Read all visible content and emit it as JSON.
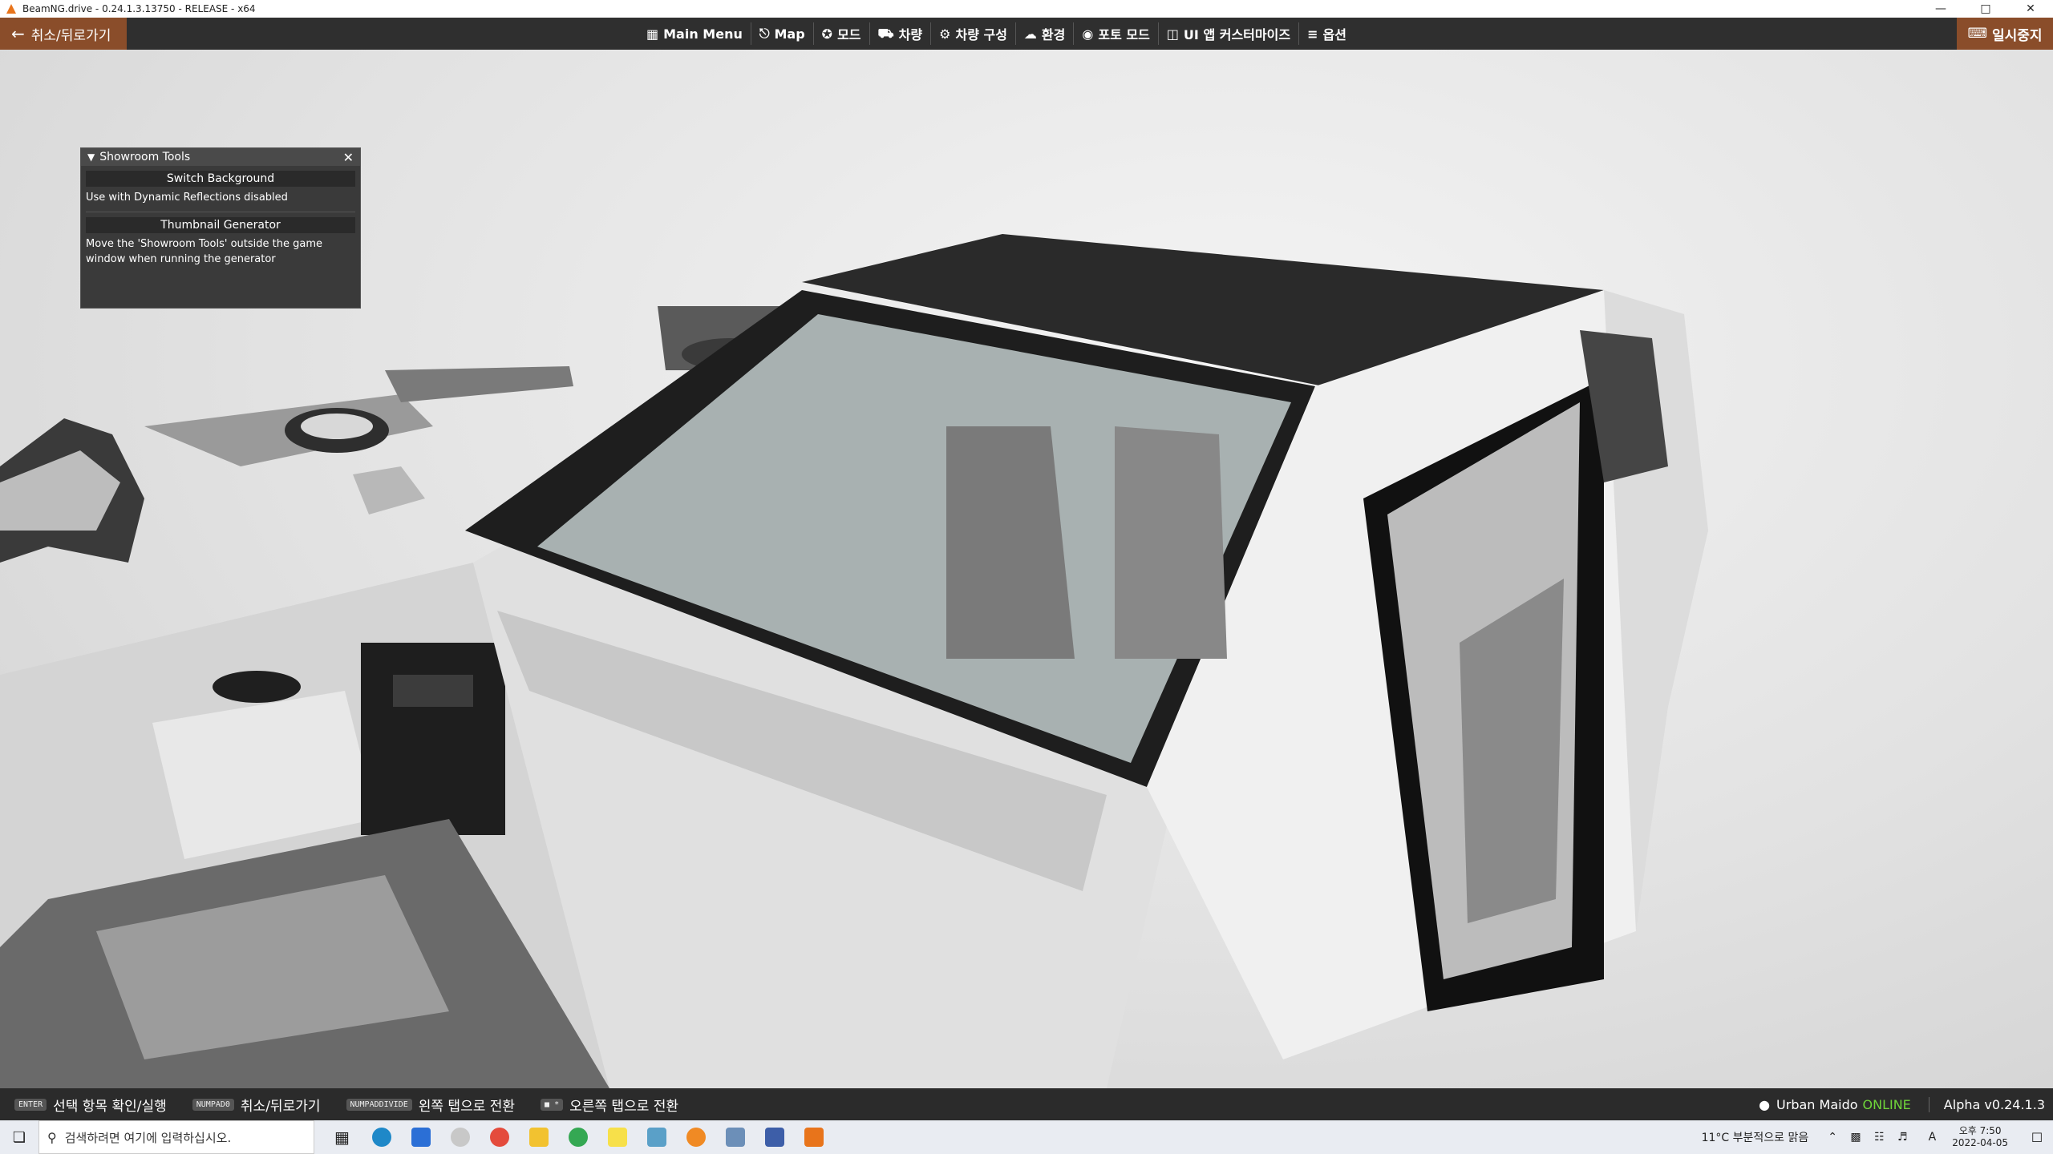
{
  "window": {
    "title": "BeamNG.drive - 0.24.1.3.13750 - RELEASE - x64",
    "minimize_icon": "minimize-icon",
    "maximize_icon": "maximize-icon",
    "close_icon": "close-icon"
  },
  "topbar": {
    "back_label": "취소/뒤로가기",
    "pause_label": "일시중지",
    "menu": [
      {
        "label": "Main Menu",
        "icon": "main-menu-icon"
      },
      {
        "label": "Map",
        "icon": "map-icon"
      },
      {
        "label": "모드",
        "icon": "puzzle-icon"
      },
      {
        "label": "차량",
        "icon": "car-icon"
      },
      {
        "label": "차량 구성",
        "icon": "car-config-icon"
      },
      {
        "label": "환경",
        "icon": "weather-icon"
      },
      {
        "label": "포토 모드",
        "icon": "camera-icon"
      },
      {
        "label": "UI 앱 커스터마이즈",
        "icon": "ui-apps-icon"
      },
      {
        "label": "옵션",
        "icon": "sliders-icon"
      }
    ],
    "accent_color": "#8a4d2a"
  },
  "showroom_panel": {
    "title": "Showroom Tools",
    "switch_background_label": "Switch Background",
    "switch_background_note": "Use with Dynamic Reflections disabled",
    "thumbnail_generator_label": "Thumbnail Generator",
    "thumbnail_generator_note_line1": "Move the 'Showroom Tools' outside the game",
    "thumbnail_generator_note_line2": "window when running the generator"
  },
  "hints": [
    {
      "key": "ENTER",
      "label": "선택 항목 확인/실행"
    },
    {
      "key": "NUMPAD0",
      "label": "취소/뒤로가기"
    },
    {
      "key": "NUMPADDIVIDE",
      "label": "왼쪽 탭으로 전환"
    },
    {
      "key": "■ *",
      "label": "오른쪽 탭으로 전환"
    }
  ],
  "status": {
    "username": "Urban Maido",
    "online": "ONLINE",
    "version": "Alpha v0.24.1.3",
    "online_color": "#6fd53a"
  },
  "taskbar": {
    "search_placeholder": "검색하려면 여기에 입력하십시오.",
    "weather": "11°C  부분적으로 맑음",
    "ime": "A",
    "time": "오후 7:50",
    "date": "2022-04-05"
  }
}
